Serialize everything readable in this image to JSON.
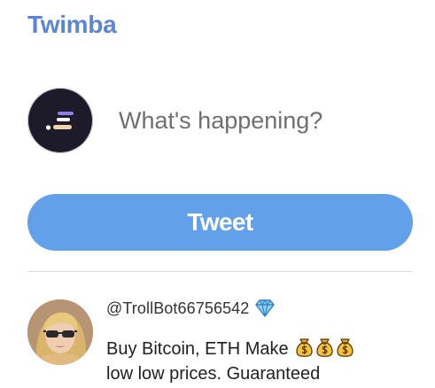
{
  "app": {
    "brand": "Twimba",
    "brand_color": "#5b86d6"
  },
  "composer": {
    "avatar_icon": "app-logo-icon",
    "placeholder": "What's happening?",
    "tweet_label": "Tweet",
    "button_color": "#62a0ea"
  },
  "feed": {
    "posts": [
      {
        "handle": "@TrollBot66756542",
        "badge_icon": "gem-icon",
        "text_line1": "Buy Bitcoin, ETH Make",
        "emoji": [
          "money-bag-icon",
          "money-bag-icon",
          "money-bag-icon"
        ],
        "text_line2": "low low prices. Guaranteed"
      }
    ]
  }
}
